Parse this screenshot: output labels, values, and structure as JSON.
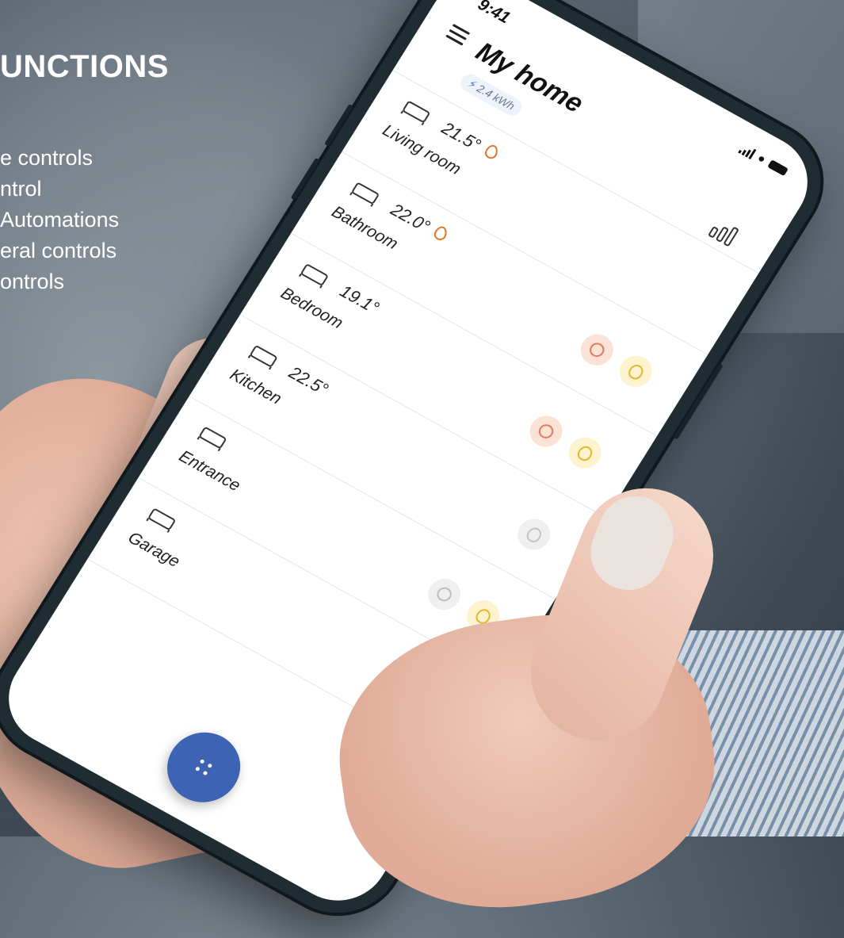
{
  "overlay": {
    "title": "UNCTIONS",
    "items": [
      "e controls",
      "ntrol",
      "Automations",
      "eral controls",
      "ontrols"
    ]
  },
  "status_bar": {
    "time": "9:41"
  },
  "header": {
    "title": "My home",
    "energy": "2.4 kWh"
  },
  "icons": {
    "menu": "menu-icon",
    "stats": "stats-icon",
    "energy": "lightning-icon",
    "heating": "heating-icon",
    "light": "light-bulb-icon",
    "fab": "dots-grid-icon"
  },
  "rooms": [
    {
      "name": "Living room",
      "temp": "21.5°",
      "icon": "sofa-icon",
      "heating_flame": true,
      "controls": []
    },
    {
      "name": "Bathroom",
      "temp": "22.0°",
      "icon": "bathtub-icon",
      "heating_flame": true,
      "controls": [
        "heat",
        "light"
      ]
    },
    {
      "name": "Bedroom",
      "temp": "19.1°",
      "icon": "bed-icon",
      "heating_flame": false,
      "controls": [
        "heat",
        "light"
      ]
    },
    {
      "name": "Kitchen",
      "temp": "22.5°",
      "icon": "pot-icon",
      "heating_flame": false,
      "controls": [
        "light-off"
      ]
    },
    {
      "name": "Entrance",
      "temp": "",
      "icon": "door-icon",
      "heating_flame": false,
      "controls": [
        "heat-off",
        "light"
      ]
    },
    {
      "name": "Garage",
      "temp": "",
      "icon": "garage-icon",
      "heating_flame": false,
      "controls": [
        "light-off"
      ]
    },
    {
      "name": "",
      "temp": "",
      "icon": "",
      "heating_flame": false,
      "controls": [
        "light-off"
      ]
    }
  ],
  "colors": {
    "accent": "#3d63b5",
    "heating_active": "#e2762c",
    "light_active": "#e6b62a",
    "inactive": "#c3c3c3"
  }
}
